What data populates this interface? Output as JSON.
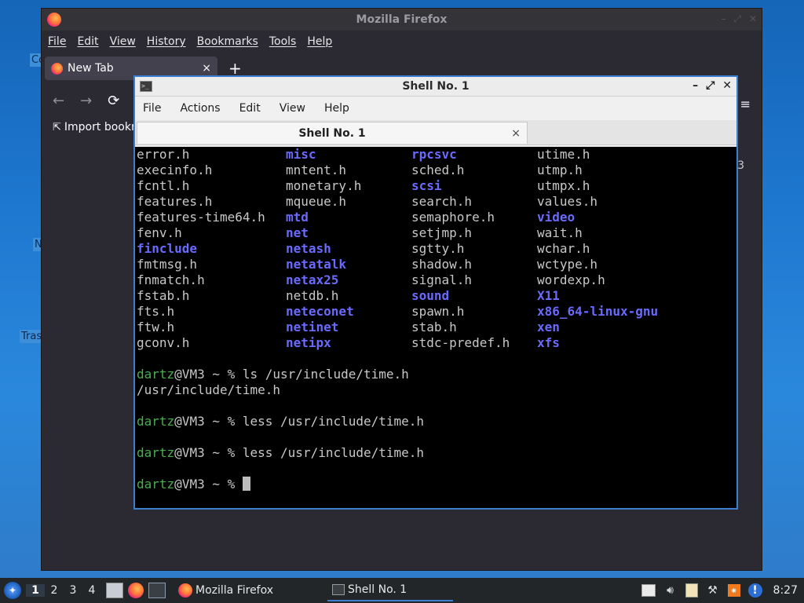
{
  "desktop": {
    "labels": [
      "Co",
      "N",
      "Tras"
    ]
  },
  "firefox": {
    "title": "Mozilla Firefox",
    "menu": [
      "File",
      "Edit",
      "View",
      "History",
      "Bookmarks",
      "Tools",
      "Help"
    ],
    "tab_label": "New Tab",
    "tab_close": "×",
    "new_tab": "+",
    "nav": {
      "back": "←",
      "forward": "→",
      "reload": "⟳"
    },
    "bookmark_label": "Import bookn",
    "overflow": "≡",
    "side_text": "3"
  },
  "terminal": {
    "title": "Shell No. 1",
    "menu": [
      "File",
      "Actions",
      "Edit",
      "View",
      "Help"
    ],
    "tab_label": "Shell No. 1",
    "tab_close": "×",
    "ls_rows": [
      [
        {
          "t": "error.h",
          "d": false
        },
        {
          "t": "misc",
          "d": true
        },
        {
          "t": "rpcsvc",
          "d": true
        },
        {
          "t": "utime.h",
          "d": false
        }
      ],
      [
        {
          "t": "execinfo.h",
          "d": false
        },
        {
          "t": "mntent.h",
          "d": false
        },
        {
          "t": "sched.h",
          "d": false
        },
        {
          "t": "utmp.h",
          "d": false
        }
      ],
      [
        {
          "t": "fcntl.h",
          "d": false
        },
        {
          "t": "monetary.h",
          "d": false
        },
        {
          "t": "scsi",
          "d": true
        },
        {
          "t": "utmpx.h",
          "d": false
        }
      ],
      [
        {
          "t": "features.h",
          "d": false
        },
        {
          "t": "mqueue.h",
          "d": false
        },
        {
          "t": "search.h",
          "d": false
        },
        {
          "t": "values.h",
          "d": false
        }
      ],
      [
        {
          "t": "features-time64.h",
          "d": false
        },
        {
          "t": "mtd",
          "d": true
        },
        {
          "t": "semaphore.h",
          "d": false
        },
        {
          "t": "video",
          "d": true
        }
      ],
      [
        {
          "t": "fenv.h",
          "d": false
        },
        {
          "t": "net",
          "d": true
        },
        {
          "t": "setjmp.h",
          "d": false
        },
        {
          "t": "wait.h",
          "d": false
        }
      ],
      [
        {
          "t": "finclude",
          "d": true
        },
        {
          "t": "netash",
          "d": true
        },
        {
          "t": "sgtty.h",
          "d": false
        },
        {
          "t": "wchar.h",
          "d": false
        }
      ],
      [
        {
          "t": "fmtmsg.h",
          "d": false
        },
        {
          "t": "netatalk",
          "d": true
        },
        {
          "t": "shadow.h",
          "d": false
        },
        {
          "t": "wctype.h",
          "d": false
        }
      ],
      [
        {
          "t": "fnmatch.h",
          "d": false
        },
        {
          "t": "netax25",
          "d": true
        },
        {
          "t": "signal.h",
          "d": false
        },
        {
          "t": "wordexp.h",
          "d": false
        }
      ],
      [
        {
          "t": "fstab.h",
          "d": false
        },
        {
          "t": "netdb.h",
          "d": false
        },
        {
          "t": "sound",
          "d": true
        },
        {
          "t": "X11",
          "d": true
        }
      ],
      [
        {
          "t": "fts.h",
          "d": false
        },
        {
          "t": "neteconet",
          "d": true
        },
        {
          "t": "spawn.h",
          "d": false
        },
        {
          "t": "x86_64-linux-gnu",
          "d": true
        }
      ],
      [
        {
          "t": "ftw.h",
          "d": false
        },
        {
          "t": "netinet",
          "d": true
        },
        {
          "t": "stab.h",
          "d": false
        },
        {
          "t": "xen",
          "d": true
        }
      ],
      [
        {
          "t": "gconv.h",
          "d": false
        },
        {
          "t": "netipx",
          "d": true
        },
        {
          "t": "stdc-predef.h",
          "d": false
        },
        {
          "t": "xfs",
          "d": true
        }
      ]
    ],
    "prompt_user": "dartz",
    "prompt_host": "@VM3 ~ % ",
    "commands": [
      "ls /usr/include/time.h",
      "less /usr/include/time.h",
      "less /usr/include/time.h"
    ],
    "output_ls": "/usr/include/time.h"
  },
  "taskbar": {
    "desktops": [
      "1",
      "2",
      "3",
      "4"
    ],
    "tasks": [
      "Mozilla Firefox",
      "Shell No. 1"
    ],
    "clock": "8:27",
    "alert": "!",
    "orange": "⁕"
  },
  "colors": {
    "directory": "#6a6aff",
    "prompt_user": "#4caf50",
    "terminal_border": "#3a7fd0"
  }
}
